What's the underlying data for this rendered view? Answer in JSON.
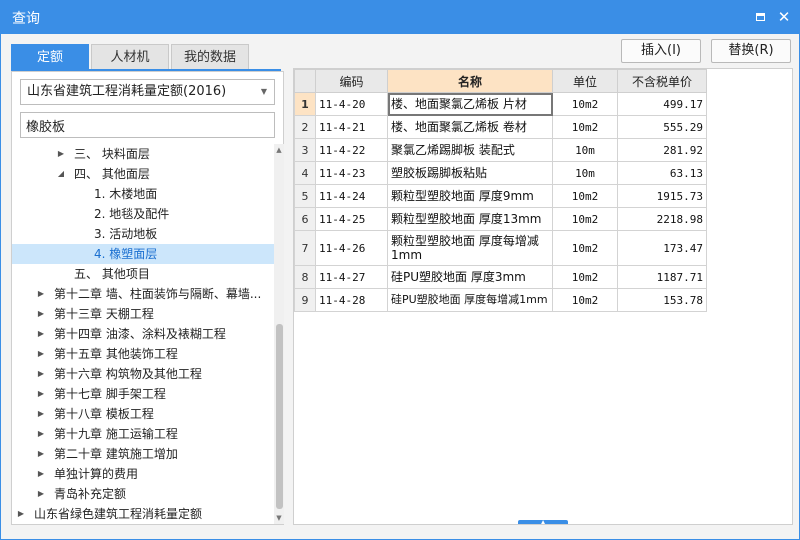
{
  "window": {
    "title": "查询",
    "maximize_icon": "maximize-icon",
    "close_icon": "close-icon"
  },
  "tabs": [
    {
      "label": "定额",
      "active": true
    },
    {
      "label": "人材机",
      "active": false
    },
    {
      "label": "我的数据",
      "active": false
    }
  ],
  "actions": {
    "insert": "插入(I)",
    "replace": "替换(R)"
  },
  "left": {
    "quota_library": "山东省建筑工程消耗量定额(2016)",
    "search_value": "橡胶板",
    "tree": [
      {
        "label": "三、 块料面层",
        "expanded": false
      },
      {
        "label": "四、 其他面层",
        "expanded": true
      },
      {
        "label": "1. 木楼地面"
      },
      {
        "label": "2. 地毯及配件"
      },
      {
        "label": "3. 活动地板"
      },
      {
        "label": "4. 橡塑面层",
        "selected": true
      },
      {
        "label": "五、 其他项目"
      },
      {
        "label": "第十二章 墙、柱面装饰与隔断、幕墙..."
      },
      {
        "label": "第十三章 天棚工程"
      },
      {
        "label": "第十四章 油漆、涂料及裱糊工程"
      },
      {
        "label": "第十五章 其他装饰工程"
      },
      {
        "label": "第十六章 构筑物及其他工程"
      },
      {
        "label": "第十七章 脚手架工程"
      },
      {
        "label": "第十八章 模板工程"
      },
      {
        "label": "第十九章 施工运输工程"
      },
      {
        "label": "第二十章 建筑施工增加"
      },
      {
        "label": "单独计算的费用"
      },
      {
        "label": "青岛补充定额"
      },
      {
        "label": "山东省绿色建筑工程消耗量定额"
      }
    ]
  },
  "table": {
    "headers": {
      "code": "编码",
      "name": "名称",
      "unit": "单位",
      "price": "不含税单价"
    },
    "rows": [
      {
        "no": "1",
        "code": "11-4-20",
        "name": "楼、地面聚氯乙烯板 片材",
        "unit": "10m2",
        "price": "499.17"
      },
      {
        "no": "2",
        "code": "11-4-21",
        "name": "楼、地面聚氯乙烯板 卷材",
        "unit": "10m2",
        "price": "555.29"
      },
      {
        "no": "3",
        "code": "11-4-22",
        "name": "聚氯乙烯踢脚板 装配式",
        "unit": "10m",
        "price": "281.92"
      },
      {
        "no": "4",
        "code": "11-4-23",
        "name": "塑胶板踢脚板粘贴",
        "unit": "10m",
        "price": "63.13"
      },
      {
        "no": "5",
        "code": "11-4-24",
        "name": "颗粒型塑胶地面 厚度9mm",
        "unit": "10m2",
        "price": "1915.73"
      },
      {
        "no": "6",
        "code": "11-4-25",
        "name": "颗粒型塑胶地面 厚度13mm",
        "unit": "10m2",
        "price": "2218.98"
      },
      {
        "no": "7",
        "code": "11-4-26",
        "name": "颗粒型塑胶地面 厚度每增减1mm",
        "unit": "10m2",
        "price": "173.47"
      },
      {
        "no": "8",
        "code": "11-4-27",
        "name": "硅PU塑胶地面 厚度3mm",
        "unit": "10m2",
        "price": "1187.71"
      },
      {
        "no": "9",
        "code": "11-4-28",
        "name": "硅PU塑胶地面 厚度每增减1mm",
        "unit": "10m2",
        "price": "153.78"
      }
    ]
  },
  "colors": {
    "accent": "#3a8ee6",
    "header_highlight": "#fde3c4",
    "tree_selected": "#cce6fb"
  }
}
